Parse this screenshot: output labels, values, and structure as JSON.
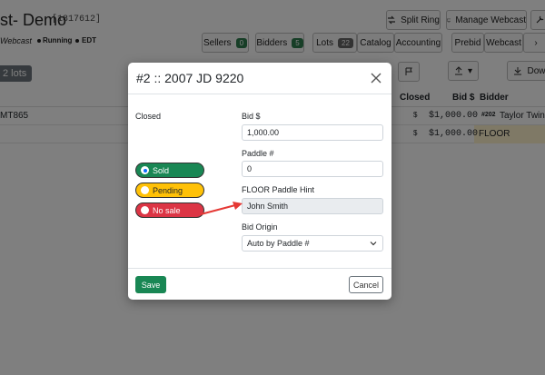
{
  "app": {
    "title": "st- Demo",
    "sale_id": "[1817612]",
    "webcast_label": "Webcast",
    "status_running": "Running",
    "timezone": "EDT",
    "buttons": {
      "split_ring": "Split Ring",
      "manage_webcast": "Manage Webcast",
      "sellers": "Sellers",
      "sellers_count": "0",
      "bidders": "Bidders",
      "bidders_count": "5",
      "lots": "Lots",
      "lots_count": "22",
      "catalog": "Catalog",
      "accounting": "Accounting",
      "prebid": "Prebid",
      "webcast": "Webcast",
      "download": "Dow"
    },
    "lots_pill": "2 lots",
    "table": {
      "headers": {
        "closed": "Closed",
        "bid": "Bid $",
        "bidder": "Bidder"
      },
      "rows": [
        {
          "lot": "MT865",
          "closed": "$",
          "bid": "$1,000.00",
          "paddle_badge": "#202",
          "bidder": "Taylor Twine"
        },
        {
          "lot": "",
          "closed": "$",
          "bid": "$1,000.00",
          "paddle_badge": "",
          "bidder": "FLOOR"
        }
      ]
    }
  },
  "modal": {
    "title": "#2 :: 2007 JD 9220",
    "closed_label": "Closed",
    "statuses": [
      {
        "label": "Sold",
        "selected": true
      },
      {
        "label": "Pending",
        "selected": false
      },
      {
        "label": "No sale",
        "selected": false
      }
    ],
    "bid_label": "Bid $",
    "bid_value": "1,000.00",
    "paddle_label": "Paddle #",
    "paddle_value": "0",
    "floor_hint_label": "FLOOR Paddle Hint",
    "floor_hint_value": "John Smith",
    "bid_origin_label": "Bid Origin",
    "bid_origin_value": "Auto by Paddle #",
    "save_label": "Save",
    "cancel_label": "Cancel"
  },
  "colors": {
    "sold": "#198754",
    "pending": "#ffc107",
    "no_sale": "#dc3545",
    "arrow": "#e53935"
  }
}
